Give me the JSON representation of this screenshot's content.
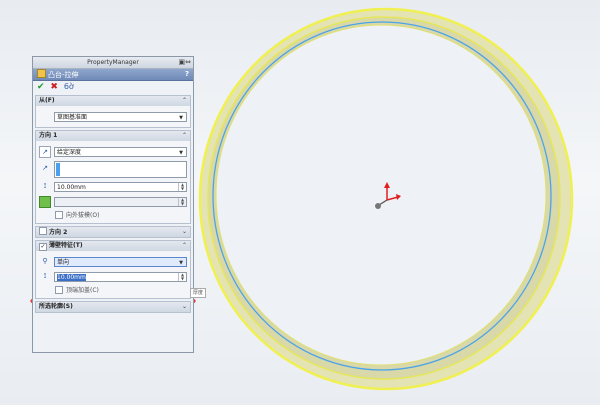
{
  "property_manager": {
    "title": "PropertyManager",
    "feature_title": "凸台-拉伸",
    "help": "?",
    "from_group": {
      "header": "从(F)",
      "start_condition": "草图基准面"
    },
    "direction1": {
      "header": "方向 1",
      "end_condition": "给定深度",
      "depth": "10.00mm",
      "draft_outward_label": "向外拔模(O)"
    },
    "direction2": {
      "header": "方向 2"
    },
    "thin_feature": {
      "header": "薄壁特征(T)",
      "type": "单向",
      "thickness": "10.00mm",
      "cap_ends_label": "顶端加盖(C)"
    },
    "selected_contours": {
      "header": "所选轮廓(S)"
    }
  },
  "tooltip": "厚度",
  "colors": {
    "ring_fill": "#dcdcb0",
    "ring_edge": "#f0f050",
    "ring_inner": "#4ba3e8",
    "annotation_red": "#e3261e",
    "triad_red": "#e02020"
  },
  "icons": {
    "ok": "checkmark-icon",
    "cancel": "close-icon",
    "detail": "detail-preview-icon",
    "direction": "direction-arrow-icon",
    "depth": "depth-icon",
    "thickness": "thickness-icon",
    "draft": "draft-icon"
  }
}
